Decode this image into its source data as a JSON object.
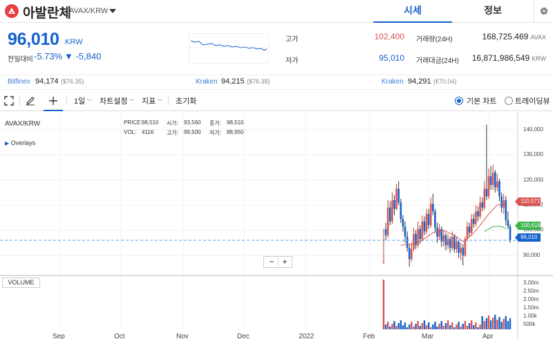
{
  "header": {
    "coin_name": "아발란체",
    "pair": "AVAX/KRW",
    "tabs": [
      {
        "label": "시세"
      },
      {
        "label": "정보"
      }
    ]
  },
  "summary": {
    "price": "96,010",
    "unit": "KRW",
    "change_label": "전일대비",
    "change_pct": "-5.73%",
    "change_abs": "▼ -5,840",
    "high_label": "고가",
    "high": "102,400",
    "low_label": "저가",
    "low": "95,010",
    "volume_label": "거래량(24H)",
    "volume": "168,725.469",
    "volume_unit": "AVAX",
    "amount_label": "거래대금(24H)",
    "amount": "16,871,986,549",
    "amount_unit": "KRW"
  },
  "exchanges": [
    {
      "name": "Bitfinex",
      "price": "94,174",
      "usd": "($76.35)"
    },
    {
      "name": "Kraken",
      "price": "94,215",
      "usd": "($76.38)"
    },
    {
      "name": "Kraken",
      "price": "94,291",
      "usd": "(€70.04)"
    }
  ],
  "toolbar": {
    "period": "1일",
    "chart_settings": "차트설정",
    "indicators": "지표",
    "reset": "초기화",
    "basic_chart": "기본 차트",
    "tradingview": "트레이딩뷰"
  },
  "chart": {
    "symbol": "AVAX/KRW",
    "overlays": "Overlays",
    "volume_button": "VOLUME",
    "ohlc": {
      "price_label": "PRICE:",
      "price": "98,510",
      "open_label": "시가:",
      "open": "93,560",
      "close_label": "종가:",
      "close": "98,510",
      "vol_label": "VOL:",
      "vol": "411K",
      "high_label": "고가:",
      "high": "99,500",
      "low_label": "저가:",
      "low": "88,950"
    },
    "zoom_minus": "−",
    "zoom_plus": "+",
    "price_tags": [
      {
        "value": "110,571",
        "color": "#d9534f"
      },
      {
        "value": "100,616",
        "color": "#3cb44b"
      },
      {
        "value": "96,010",
        "color": "#1561cc"
      }
    ]
  },
  "chart_data": {
    "type": "candlestick",
    "x_labels": [
      "Sep",
      "Oct",
      "Nov",
      "Dec",
      "2022",
      "Feb",
      "Mar",
      "Apr"
    ],
    "y_ticks": [
      "140,000",
      "130,000",
      "120,000",
      "110,000",
      "100,000",
      "90,000"
    ],
    "y_range": [
      82000,
      146000
    ],
    "volume_ticks": [
      "3.00m",
      "2.50m",
      "2.00m",
      "1.50m",
      "1.00k",
      "500k"
    ],
    "last_price": 96010,
    "candles": [
      [
        87500,
        87500,
        100500,
        86500
      ],
      [
        100500,
        98000,
        103000,
        96000
      ],
      [
        98000,
        109000,
        112000,
        97000
      ],
      [
        109000,
        103500,
        111500,
        102000
      ],
      [
        103500,
        112000,
        115000,
        102500
      ],
      [
        112000,
        108500,
        114000,
        106000
      ],
      [
        108500,
        116500,
        118500,
        108000
      ],
      [
        116500,
        111000,
        119500,
        110000
      ],
      [
        111000,
        104500,
        112500,
        103000
      ],
      [
        104500,
        101500,
        106000,
        99500
      ],
      [
        101500,
        97500,
        103500,
        95000
      ],
      [
        97500,
        93000,
        99500,
        91500
      ],
      [
        93000,
        88500,
        94500,
        85500
      ],
      [
        88500,
        92500,
        95000,
        87500
      ],
      [
        92500,
        98500,
        101000,
        91500
      ],
      [
        98500,
        94000,
        100000,
        92500
      ],
      [
        94000,
        100500,
        103500,
        93000
      ],
      [
        100500,
        96500,
        102000,
        94500
      ],
      [
        96500,
        103500,
        106000,
        95500
      ],
      [
        103500,
        99500,
        105500,
        98000
      ],
      [
        99500,
        106500,
        108500,
        98500
      ],
      [
        106500,
        102000,
        108500,
        100500
      ],
      [
        102000,
        110500,
        113000,
        101000
      ],
      [
        110500,
        107500,
        114500,
        106000
      ],
      [
        107500,
        101000,
        108500,
        99000
      ],
      [
        101000,
        97500,
        103000,
        95000
      ],
      [
        97500,
        100500,
        102500,
        96000
      ],
      [
        100500,
        95500,
        101500,
        93500
      ],
      [
        95500,
        98000,
        100000,
        93500
      ],
      [
        98000,
        94000,
        99000,
        92000
      ],
      [
        94000,
        96500,
        98500,
        92500
      ],
      [
        96500,
        93000,
        97500,
        91000
      ],
      [
        93000,
        97500,
        99500,
        92000
      ],
      [
        97500,
        92500,
        98500,
        91000
      ],
      [
        92500,
        95500,
        97500,
        91000
      ],
      [
        95500,
        91000,
        96000,
        89000
      ],
      [
        91000,
        93000,
        95000,
        88000
      ],
      [
        93000,
        90000,
        94500,
        86000
      ],
      [
        90000,
        96500,
        97500,
        89500
      ],
      [
        96500,
        101500,
        103500,
        95500
      ],
      [
        101500,
        99000,
        103000,
        97500
      ],
      [
        99000,
        104500,
        106500,
        98000
      ],
      [
        104500,
        102500,
        106500,
        101000
      ],
      [
        102500,
        107500,
        110000,
        101500
      ],
      [
        107500,
        105500,
        109500,
        103500
      ],
      [
        105500,
        111000,
        113500,
        104500
      ],
      [
        111000,
        109000,
        113000,
        107500
      ],
      [
        109000,
        116500,
        119500,
        108000
      ],
      [
        116500,
        113500,
        142000,
        112000
      ],
      [
        113500,
        121500,
        124500,
        112500
      ],
      [
        121500,
        118000,
        125500,
        116000
      ],
      [
        118000,
        123000,
        126000,
        116000
      ],
      [
        123000,
        117000,
        124000,
        115000
      ],
      [
        117000,
        119500,
        122500,
        115500
      ],
      [
        119500,
        113500,
        120500,
        111500
      ],
      [
        113500,
        109000,
        115000,
        107000
      ],
      [
        109000,
        112000,
        114500,
        106500
      ],
      [
        112000,
        104000,
        113500,
        102000
      ],
      [
        104000,
        101500,
        107500,
        100500
      ],
      [
        101500,
        96000,
        102500,
        95000
      ]
    ],
    "ma_red": [
      [
        8,
        94000
      ],
      [
        13,
        94500
      ],
      [
        18,
        96000
      ],
      [
        23,
        99000
      ],
      [
        28,
        100000
      ],
      [
        33,
        98000
      ],
      [
        37,
        95500
      ],
      [
        41,
        98000
      ],
      [
        45,
        102000
      ],
      [
        49,
        106500
      ],
      [
        53,
        110000
      ],
      [
        57,
        110600
      ]
    ],
    "ma_green": [
      [
        47,
        99500
      ],
      [
        51,
        101500
      ],
      [
        55,
        101500
      ],
      [
        57,
        100600
      ]
    ]
  }
}
